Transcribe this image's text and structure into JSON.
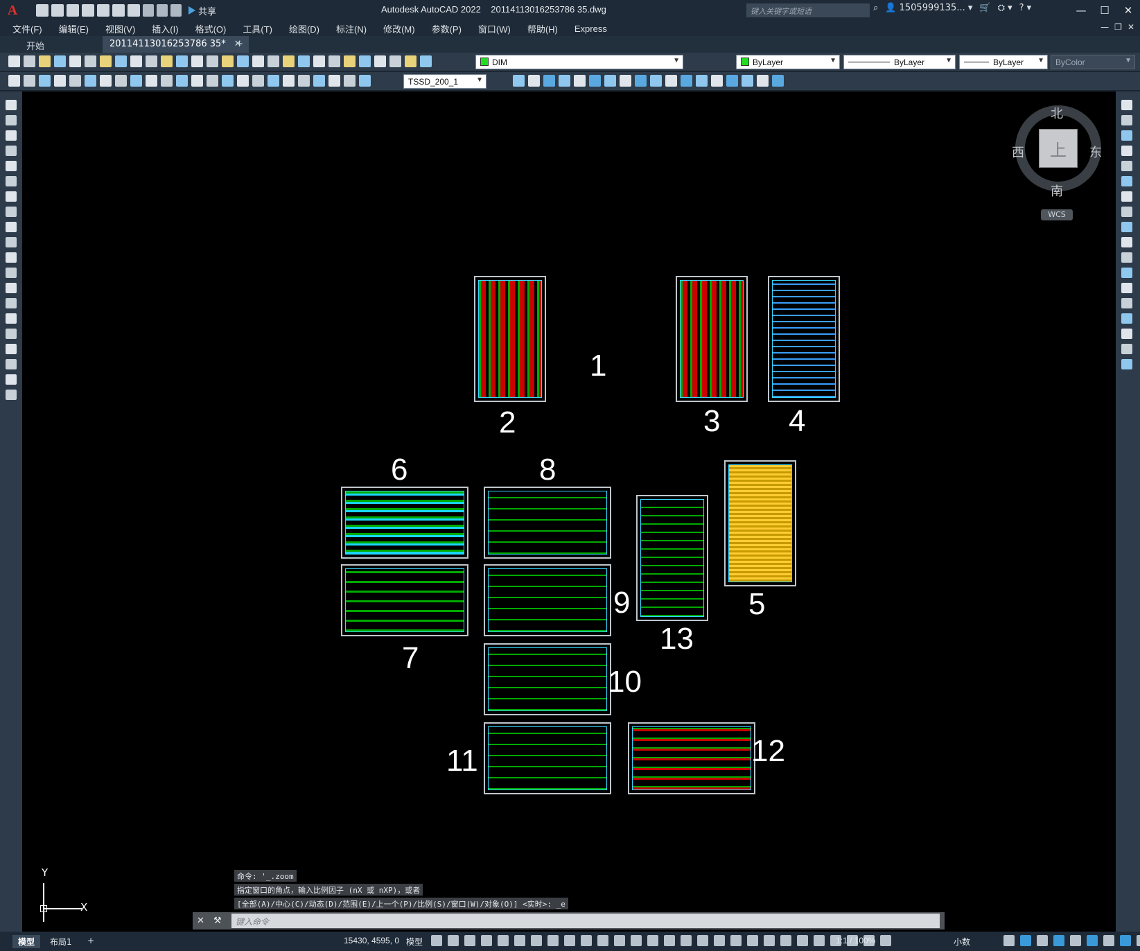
{
  "app": {
    "logo": "A",
    "title": "Autodesk AutoCAD 2022",
    "file": "20114113016253786 35.dwg",
    "share": "共享"
  },
  "search": {
    "placeholder": "键入关键字或短语"
  },
  "user": {
    "name": "1505999135..."
  },
  "menu": [
    "文件(F)",
    "编辑(E)",
    "视图(V)",
    "插入(I)",
    "格式(O)",
    "工具(T)",
    "绘图(D)",
    "标注(N)",
    "修改(M)",
    "参数(P)",
    "窗口(W)",
    "帮助(H)",
    "Express"
  ],
  "tabs": {
    "start": "开始",
    "doc": "20114113016253786 35*"
  },
  "toolbar": {
    "layer": "DIM",
    "layer_color": "#22dd22",
    "color": "ByLayer",
    "color_swatch": "#22dd22",
    "linetype": "ByLayer",
    "lineweight": "ByLayer",
    "plotstyle": "ByColor",
    "dimstyle": "TSSD_200_1"
  },
  "viewcube": {
    "top": "上",
    "north": "北",
    "south": "南",
    "east": "东",
    "west": "西",
    "wcs": "WCS"
  },
  "sheet_labels": [
    "1",
    "2",
    "3",
    "4",
    "5",
    "6",
    "7",
    "8",
    "9",
    "10",
    "11",
    "12",
    "13"
  ],
  "ucs": {
    "y": "Y",
    "x": "X"
  },
  "command": {
    "history": [
      "命令: '_.zoom",
      "指定窗口的角点，输入比例因子 (nX 或 nXP)，或者",
      "[全部(A)/中心(C)/动态(D)/范围(E)/上一个(P)/比例(S)/窗口(W)/对象(O)] <实时>: _e"
    ],
    "placeholder": "键入命令"
  },
  "status": {
    "model_tab": "模型",
    "layout_tab": "布局1",
    "add": "+",
    "coords": "15430, 4595, 0",
    "space": "模型",
    "scale": "1:1 / 100%",
    "units": "小数"
  }
}
